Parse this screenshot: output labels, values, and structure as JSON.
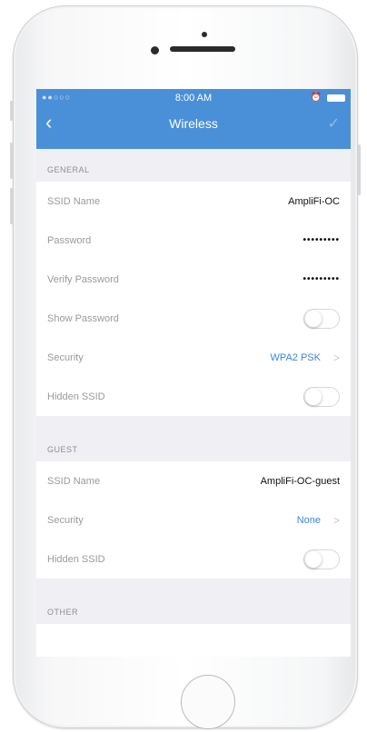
{
  "status_bar": {
    "signal": "●●○○○",
    "time": "8:00 AM"
  },
  "nav": {
    "back_glyph": "‹",
    "title": "Wireless",
    "done_glyph": "✓"
  },
  "sections": {
    "general": {
      "header": "GENERAL",
      "rows": [
        {
          "label": "SSID Name",
          "value": "AmpliFi-OC"
        },
        {
          "label": "Password",
          "value": "•••••••••"
        },
        {
          "label": "Verify Password",
          "value": "•••••••••"
        },
        {
          "label": "Show Password",
          "toggle": false
        },
        {
          "label": "Security",
          "value": "WPA2 PSK"
        },
        {
          "label": "Hidden SSID",
          "toggle": false
        }
      ]
    },
    "guest": {
      "header": "GUEST",
      "rows": [
        {
          "label": "SSID Name",
          "value": "AmpliFi-OC-guest"
        },
        {
          "label": "Security",
          "value": "None"
        },
        {
          "label": "Hidden SSID",
          "toggle": false
        }
      ]
    },
    "other": {
      "header": "OTHER"
    }
  },
  "colors": {
    "nav_blue": "#4a90d9",
    "link_blue": "#3b87d8",
    "background": "#efeff4"
  }
}
